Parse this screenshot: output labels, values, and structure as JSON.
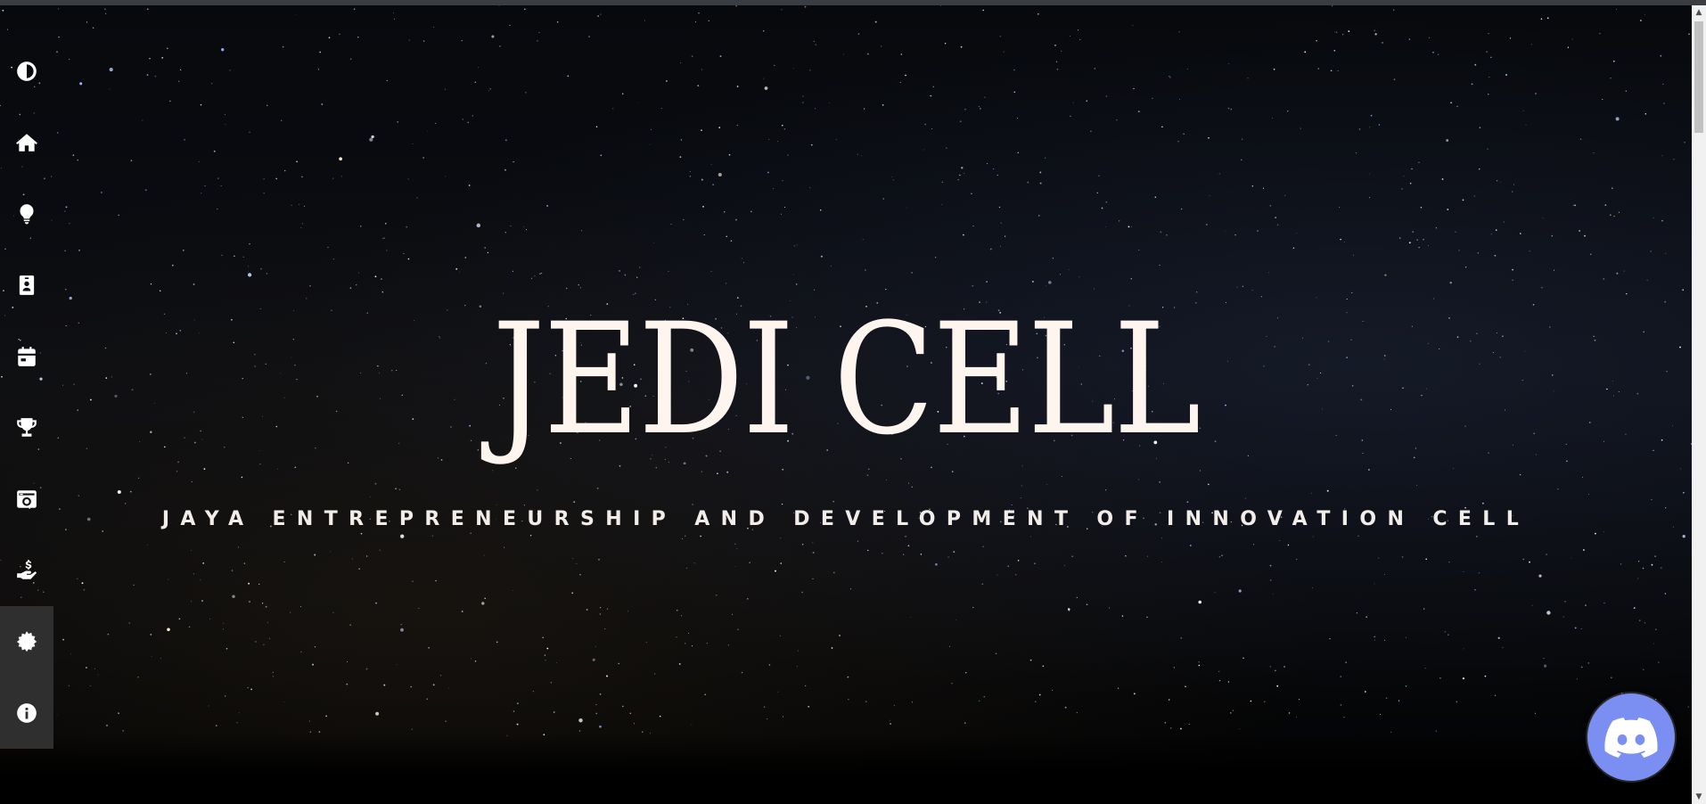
{
  "hero": {
    "title": "JEDI CELL",
    "subtitle": "JAYA ENTREPRENEURSHIP AND DEVELOPMENT OF INNOVATION CELL"
  },
  "sidebar": {
    "items": [
      {
        "name": "theme-toggle",
        "icon": "contrast-icon"
      },
      {
        "name": "home",
        "icon": "home-icon"
      },
      {
        "name": "ideas",
        "icon": "lightbulb-icon"
      },
      {
        "name": "team",
        "icon": "id-badge-icon"
      },
      {
        "name": "events",
        "icon": "calendar-icon"
      },
      {
        "name": "achievements",
        "icon": "trophy-icon"
      },
      {
        "name": "gallery",
        "icon": "camera-icon"
      },
      {
        "name": "funding",
        "icon": "hand-dollar-icon"
      },
      {
        "name": "settings",
        "icon": "gear-icon",
        "active": true
      },
      {
        "name": "about",
        "icon": "info-icon"
      }
    ]
  },
  "floating": {
    "icon": "discord-icon"
  },
  "colors": {
    "title": "#fff5ef",
    "subtitle": "#f2ede8",
    "sidebar_active": "#2f2f2f",
    "discord": "#7b8ef2"
  }
}
